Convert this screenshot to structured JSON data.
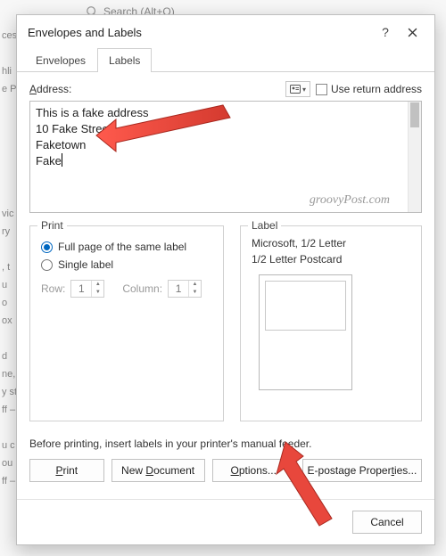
{
  "backdrop": {
    "search_placeholder": "Search (Alt+Q)",
    "side_text": "ces:\n\nhli\ne P\n\n\n\n\n\n\nvic\nry\n\n, t\nu\no\nox\n\nd\nne,\ny st\nff –\n\nu c\nou\nff –"
  },
  "dialog": {
    "title": "Envelopes and Labels",
    "tabs": {
      "envelopes": "Envelopes",
      "labels": "Labels"
    },
    "address": {
      "label_pre": "A",
      "label_rest": "ddress:",
      "use_return": "Use return address",
      "lines": [
        "This is a fake address",
        "10 Fake Street",
        "Faketown",
        "Fake"
      ],
      "watermark": "groovyPost.com"
    },
    "print": {
      "legend": "Print",
      "full_pre": "F",
      "full_rest": "ull page of the same label",
      "single_pre": "Singl",
      "single_u": "e",
      "single_rest": " label",
      "row_label": "Row:",
      "row_val": "1",
      "col_label": "Column:",
      "col_val": "1"
    },
    "label": {
      "legend": "Label",
      "line1": "Microsoft, 1/2 Letter",
      "line2": "1/2 Letter Postcard"
    },
    "hint": "Before printing, insert labels in your printer's manual feeder.",
    "buttons": {
      "print_u": "P",
      "print_rest": "rint",
      "newdoc_pre": "New ",
      "newdoc_u": "D",
      "newdoc_rest": "ocument",
      "options_u": "O",
      "options_rest": "ptions...",
      "epost_pre": "E-postage Proper",
      "epost_u": "t",
      "epost_rest": "ies...",
      "cancel": "Cancel"
    }
  }
}
